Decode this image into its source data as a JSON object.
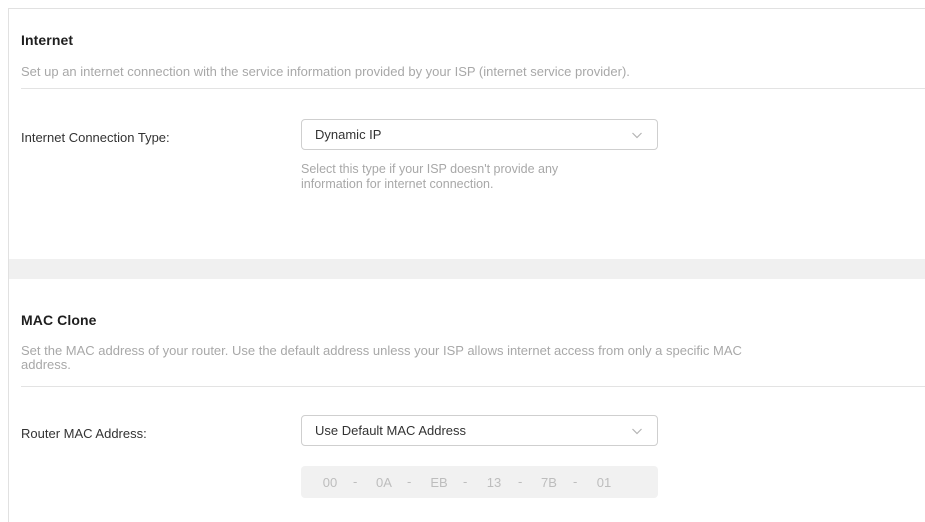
{
  "internet": {
    "title": "Internet",
    "description": "Set up an internet connection with the service information provided by your ISP (internet service provider).",
    "connection_type_label": "Internet Connection Type:",
    "connection_type_value": "Dynamic IP",
    "hint_line1": "Select this type if your ISP doesn't provide any",
    "hint_line2": "information for internet connection."
  },
  "mac_clone": {
    "title": "MAC Clone",
    "description_line1": "Set the MAC address of your router. Use the default address unless your ISP allows internet access from only a specific MAC",
    "description_line2": "address.",
    "router_mac_label": "Router MAC Address:",
    "router_mac_value": "Use Default MAC Address",
    "mac_octets": [
      "00",
      "0A",
      "EB",
      "13",
      "7B",
      "01"
    ],
    "mac_separator": "-"
  },
  "icons": {
    "dropdown": "chevron-down-icon"
  },
  "colors": {
    "divider": "#e3e3e3",
    "muted_text": "#a8a8a8",
    "section_gap": "#f0f0f0"
  }
}
